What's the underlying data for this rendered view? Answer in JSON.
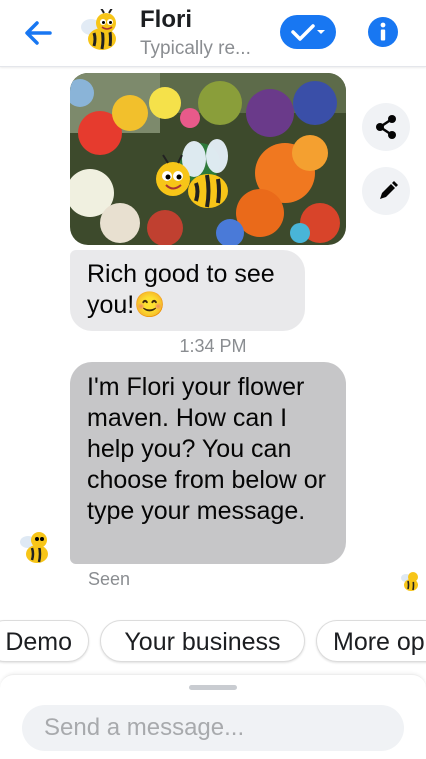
{
  "header": {
    "contact_name": "Flori",
    "contact_status": "Typically re...",
    "accent_color": "#1877f2"
  },
  "messages": [
    {
      "type": "image",
      "description_icon": "flowers-bee-image"
    },
    {
      "type": "text",
      "text": "Rich good to see you!😊"
    },
    {
      "type": "timestamp",
      "text": "1:34 PM"
    },
    {
      "type": "text",
      "text": "I'm Flori your flower maven.  How can I help you?  You can choose from below or type your message."
    }
  ],
  "seen_label": "Seen",
  "quick_replies": [
    "Demo",
    "Your business",
    "More op"
  ],
  "composer": {
    "placeholder": "Send a message..."
  }
}
